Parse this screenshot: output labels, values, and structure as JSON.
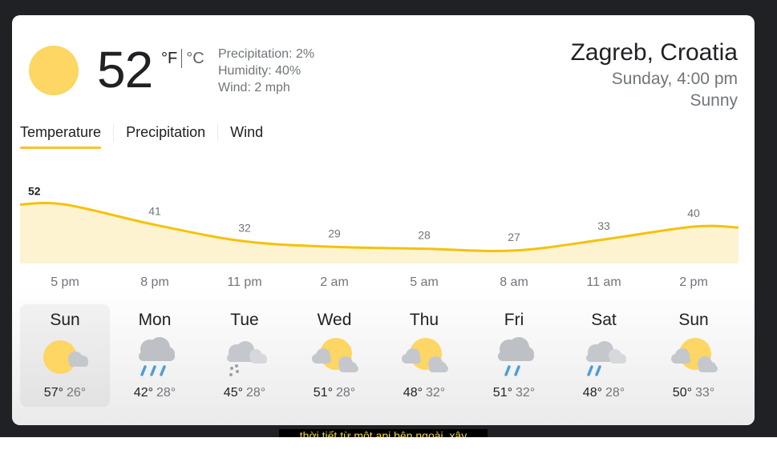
{
  "current": {
    "temperature": "52",
    "unit_f": "°F",
    "unit_c": "°C",
    "precipitation": "Precipitation: 2%",
    "humidity": "Humidity: 40%",
    "wind": "Wind: 2 mph",
    "icon": "sun-icon"
  },
  "location": {
    "name": "Zagreb, Croatia",
    "time": "Sunday, 4:00 pm",
    "condition": "Sunny"
  },
  "tabs": [
    {
      "label": "Temperature",
      "active": true
    },
    {
      "label": "Precipitation",
      "active": false
    },
    {
      "label": "Wind",
      "active": false
    }
  ],
  "chart_data": {
    "type": "area",
    "x": [
      "5 pm",
      "8 pm",
      "11 pm",
      "2 am",
      "5 am",
      "8 am",
      "11 am",
      "2 pm"
    ],
    "values": [
      52,
      41,
      32,
      29,
      28,
      27,
      33,
      40
    ],
    "color": "#f4c20d",
    "fill": "#fdf3d0"
  },
  "forecast": [
    {
      "day": "Sun",
      "hi": "57°",
      "lo": "26°",
      "icon": "partly-sunny-icon",
      "selected": true
    },
    {
      "day": "Mon",
      "hi": "42°",
      "lo": "28°",
      "icon": "rain-icon",
      "selected": false
    },
    {
      "day": "Tue",
      "hi": "45°",
      "lo": "28°",
      "icon": "snow-showers-icon",
      "selected": false
    },
    {
      "day": "Wed",
      "hi": "51°",
      "lo": "28°",
      "icon": "mostly-sunny-icon",
      "selected": false
    },
    {
      "day": "Thu",
      "hi": "48°",
      "lo": "32°",
      "icon": "mostly-sunny-icon",
      "selected": false
    },
    {
      "day": "Fri",
      "hi": "51°",
      "lo": "32°",
      "icon": "showers-icon",
      "selected": false
    },
    {
      "day": "Sat",
      "hi": "48°",
      "lo": "28°",
      "icon": "scattered-showers-icon",
      "selected": false
    },
    {
      "day": "Sun",
      "hi": "50°",
      "lo": "33°",
      "icon": "mostly-sunny-icon",
      "selected": false
    }
  ],
  "caption": "thời tiết từ một api bên ngoài, xây",
  "colors": {
    "background": "#202124",
    "accent": "#fbc02d",
    "sun": "#fdd663",
    "cloud": "#c4c7cc",
    "rain": "#4a9fd8"
  }
}
